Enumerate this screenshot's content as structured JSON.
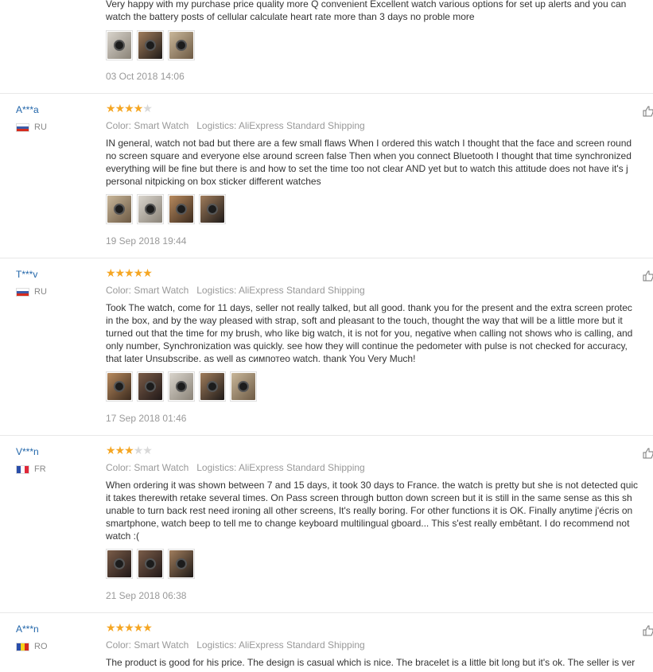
{
  "reviews": [
    {
      "user": "",
      "country": "",
      "stars": 0,
      "color": "",
      "logistics": "",
      "lines": [
        "Very happy with my purchase price quality more Q convenient Excellent watch various options for set up alerts and you can",
        "watch the battery posts of cellular calculate heart rate more than 3 days no proble more"
      ],
      "photos": 3,
      "date": "03 Oct 2018 14:06"
    },
    {
      "user": "A***a",
      "country": "RU",
      "stars": 4,
      "color": "Color: Smart Watch",
      "logistics": "Logistics: AliExpress Standard Shipping",
      "lines": [
        "IN general, watch not bad but there are a few small flaws When I ordered this watch I thought that the face and screen round",
        "no screen square and everyone else around screen false Then when you connect Bluetooth I thought that time synchronized",
        "everything will be fine but there is and how to set the time too not clear AND yet but to watch this attitude does not have it's j",
        "personal nitpicking on box sticker different watches"
      ],
      "photos": 4,
      "date": "19 Sep 2018 19:44"
    },
    {
      "user": "T***v",
      "country": "RU",
      "stars": 5,
      "color": "Color: Smart Watch",
      "logistics": "Logistics: AliExpress Standard Shipping",
      "lines": [
        "Took The watch, come for 11 days, seller not really talked, but all good. thank you for the present and the extra screen protec",
        "in the box, and by the way pleased with strap, soft and pleasant to the touch, thought the way that will be a little more but it",
        "turned out that the time for my brush, who like big watch, it is not for you, negative when calling not shows who is calling, and",
        "only number, Synchronization was quickly. see how they will continue the pedometer with pulse is not checked for accuracy,",
        "that later Unsubscribe. as well as симпотео watch. thank You Very Much!"
      ],
      "photos": 5,
      "date": "17 Sep 2018 01:46"
    },
    {
      "user": "V***n",
      "country": "FR",
      "stars": 3,
      "color": "Color: Smart Watch",
      "logistics": "Logistics: AliExpress Standard Shipping",
      "lines": [
        "When ordering it was shown between 7 and 15 days, it took 30 days to France. the watch is pretty but she is not detected quic",
        "it takes therewith retake several times. On Pass screen through button down screen but it is still in the same sense as this sh",
        "unable to turn back rest need ironing all other screens, It's really boring. For other functions it is OK. Finally anytime j'écris on",
        "smartphone, watch beep to tell me to change keyboard multilingual gboard... This s'est really embêtant. I do recommend not",
        "watch :("
      ],
      "photos": 3,
      "date": "21 Sep 2018 06:38"
    },
    {
      "user": "A***n",
      "country": "RO",
      "stars": 5,
      "color": "Color: Smart Watch",
      "logistics": "Logistics: AliExpress Standard Shipping",
      "lines": [
        "The product is good for his price. The design is casual which is nice. The bracelet is a little bit long but it's ok. The seller is ver"
      ],
      "photos": 0,
      "date": ""
    }
  ]
}
